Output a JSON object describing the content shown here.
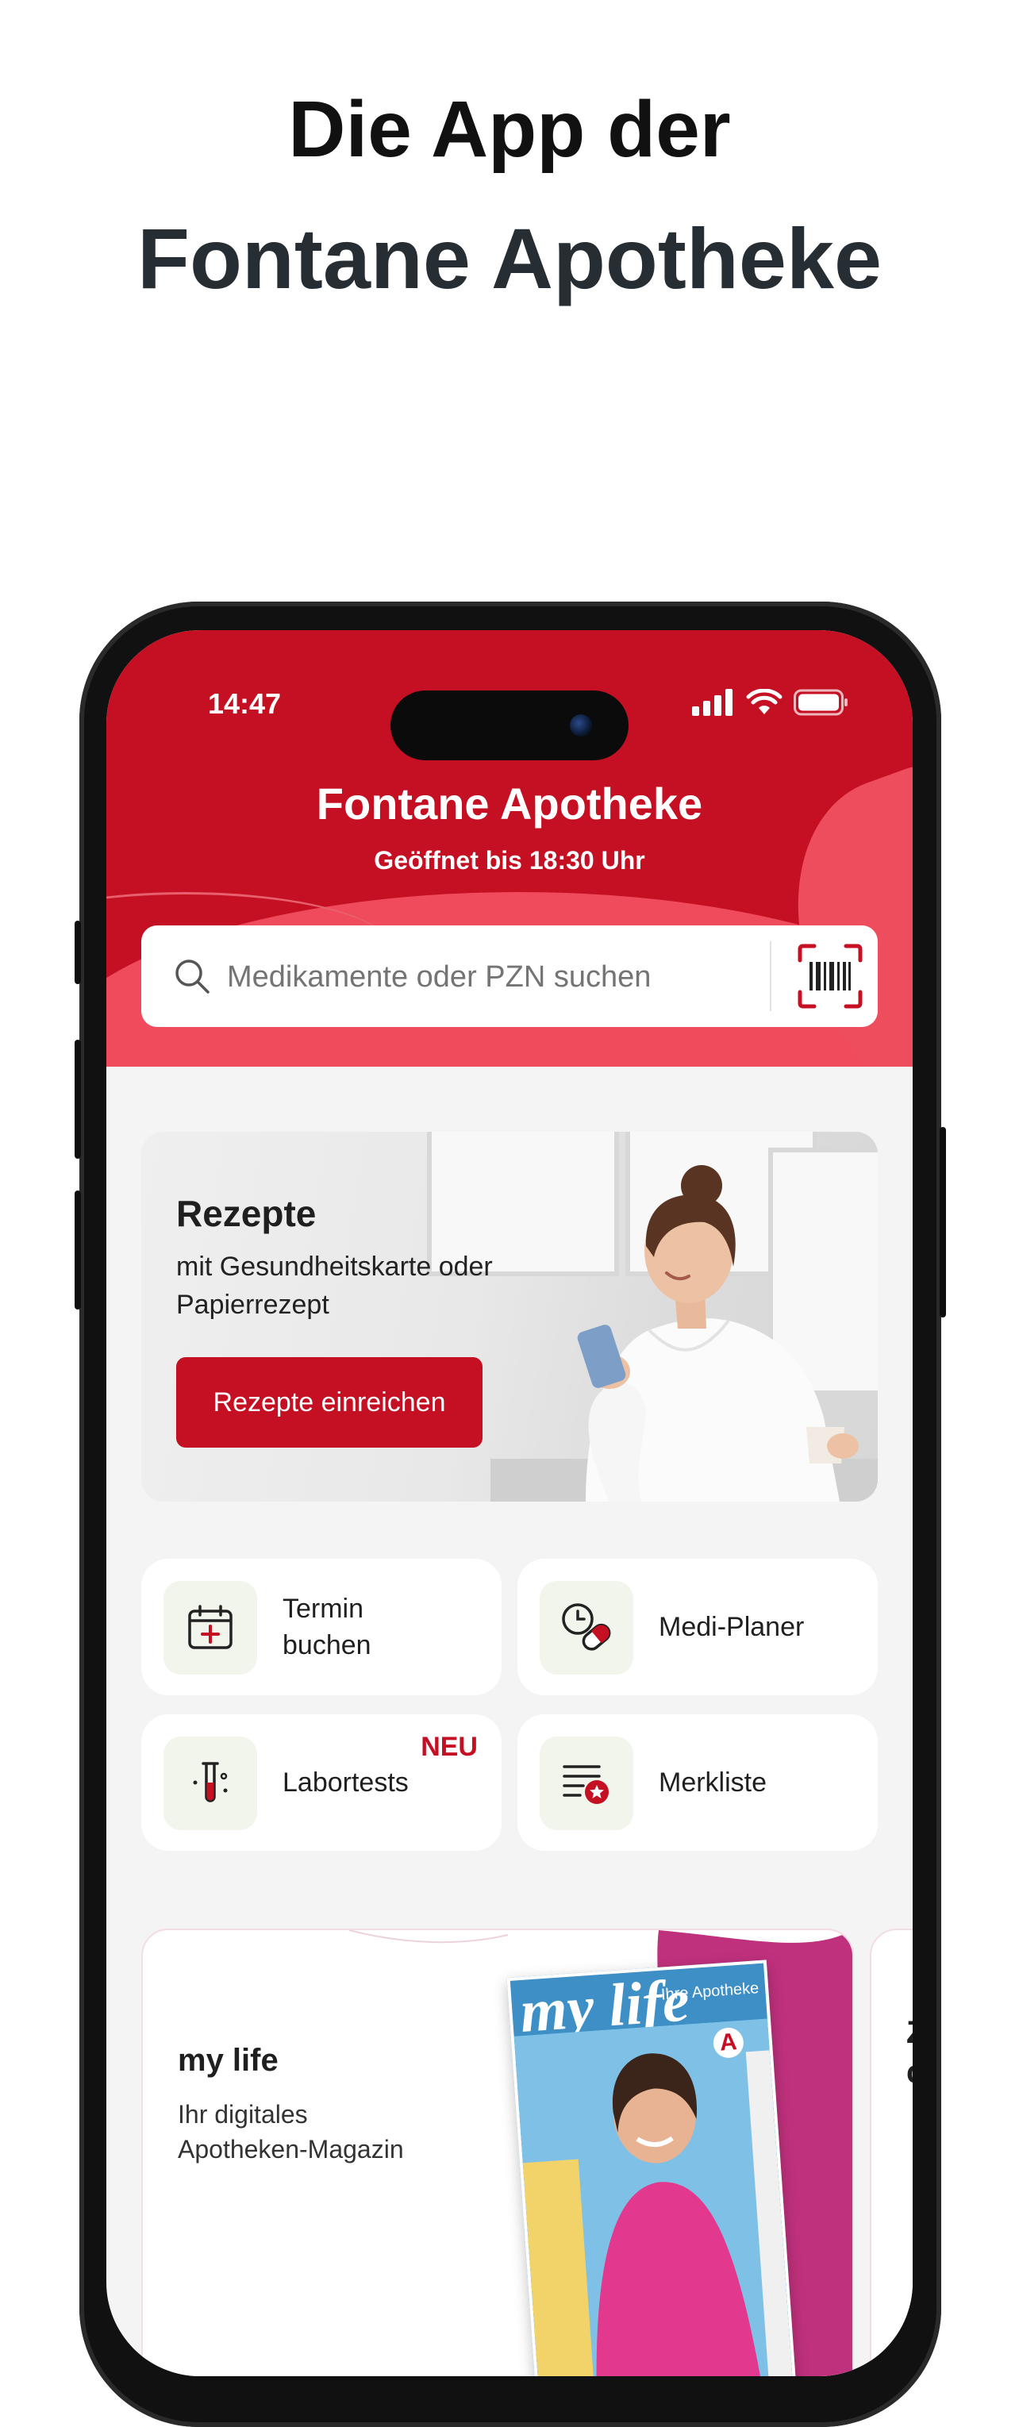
{
  "marketing": {
    "line1": "Die App der",
    "line2": "Fontane Apotheke"
  },
  "status_bar": {
    "time": "14:47"
  },
  "header": {
    "title": "Fontane Apotheke",
    "subtitle": "Geöffnet bis 18:30 Uhr"
  },
  "search": {
    "placeholder": "Medikamente oder PZN suchen"
  },
  "rezepte_card": {
    "title": "Rezepte",
    "text": "mit Gesundheitskarte oder Papierrezept",
    "button": "Rezepte einreichen"
  },
  "tiles": [
    {
      "label_line1": "Termin",
      "label_line2": "buchen",
      "icon": "calendar-plus-icon"
    },
    {
      "label": "Medi-Planer",
      "icon": "clock-pill-icon"
    },
    {
      "label": "Labortests",
      "badge": "NEU",
      "icon": "test-tube-icon"
    },
    {
      "label": "Merkliste",
      "icon": "list-star-icon"
    }
  ],
  "magazine_card": {
    "title": "my life",
    "text_line1": "Ihr digitales",
    "text_line2": "Apotheken-Magazin",
    "cover_title": "my life",
    "cover_sub": "Ihre Apotheke"
  },
  "next_card_peek": {
    "line1": "Z",
    "line2": "c"
  },
  "colors": {
    "brand_red": "#c50f22",
    "blob_red": "#ef4b5c",
    "tile_icon_bg": "#f2f5ec",
    "background": "#f4f4f4"
  }
}
